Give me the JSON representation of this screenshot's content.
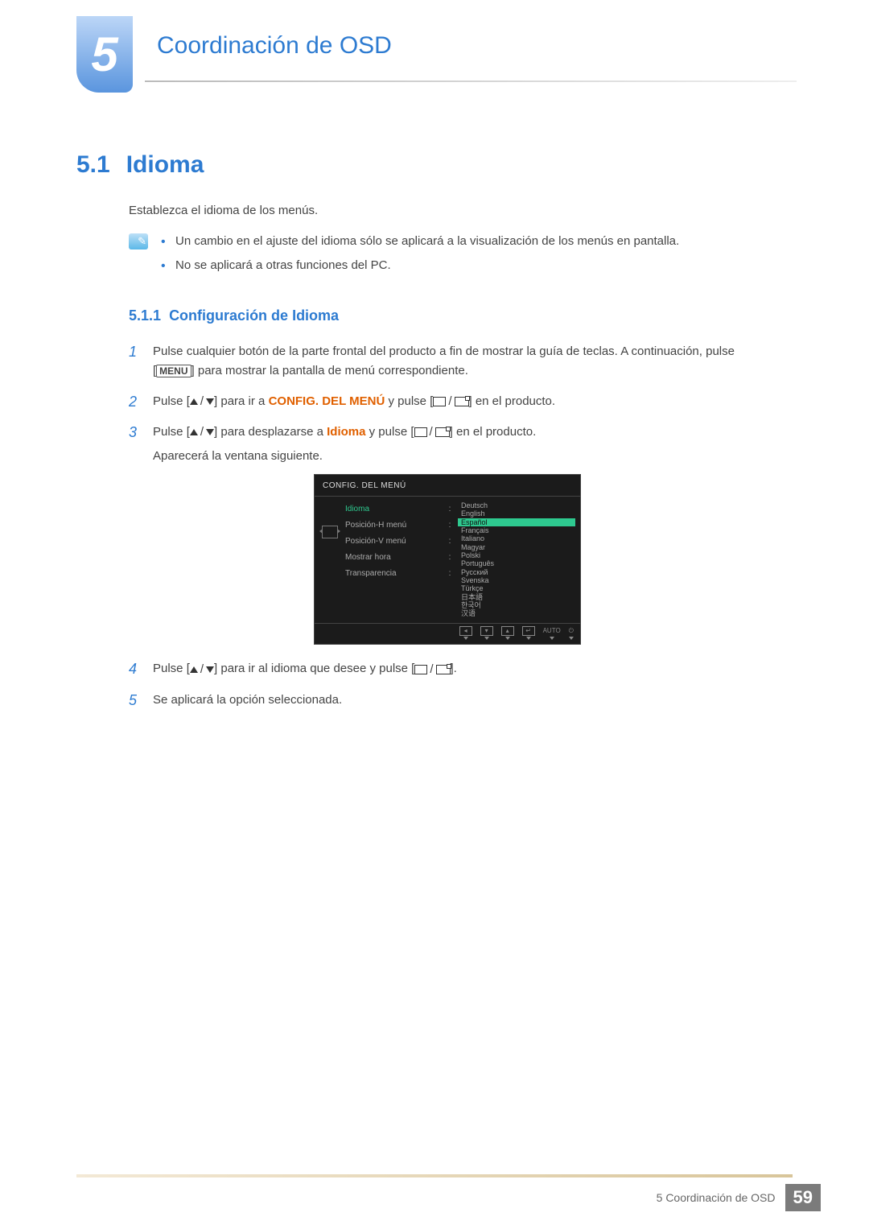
{
  "chapter": {
    "number": "5",
    "title": "Coordinación de OSD"
  },
  "section": {
    "number": "5.1",
    "title": "Idioma"
  },
  "intro": "Establezca el idioma de los menús.",
  "notes": [
    "Un cambio en el ajuste del idioma sólo se aplicará a la visualización de los menús en pantalla.",
    "No se aplicará a otras funciones del PC."
  ],
  "subsection": {
    "number": "5.1.1",
    "title": "Configuración de Idioma"
  },
  "steps": {
    "s1a": "Pulse cualquier botón de la parte frontal del producto a fin de mostrar la guía de teclas. A continuación, pulse [",
    "s1_menu": "MENU",
    "s1b": "] para mostrar la pantalla de menú correspondiente.",
    "s2a": "Pulse [",
    "s2b": "] para ir a ",
    "s2_target": "CONFIG. DEL MENÚ",
    "s2c": " y pulse [",
    "s2d": "] en el producto.",
    "s3a": "Pulse [",
    "s3b": "] para desplazarse a ",
    "s3_target": "Idioma",
    "s3c": " y pulse [",
    "s3d": "] en el producto.",
    "s3e": "Aparecerá la ventana siguiente.",
    "s4a": "Pulse [",
    "s4b": "] para ir al idioma que desee y pulse [",
    "s4c": "].",
    "s5": "Se aplicará la opción seleccionada."
  },
  "osd": {
    "title": "CONFIG. DEL MENÚ",
    "menu": [
      "Idioma",
      "Posición-H menú",
      "Posición-V menú",
      "Mostrar hora",
      "Transparencia"
    ],
    "languages": [
      "Deutsch",
      "English",
      "Español",
      "Français",
      "Italiano",
      "Magyar",
      "Polski",
      "Português",
      "Русский",
      "Svenska",
      "Türkçe",
      "日本語",
      "한국어",
      "汉语"
    ],
    "selected_language_index": 2,
    "footer_auto": "AUTO"
  },
  "footer": {
    "text": "5 Coordinación de OSD",
    "page": "59"
  }
}
